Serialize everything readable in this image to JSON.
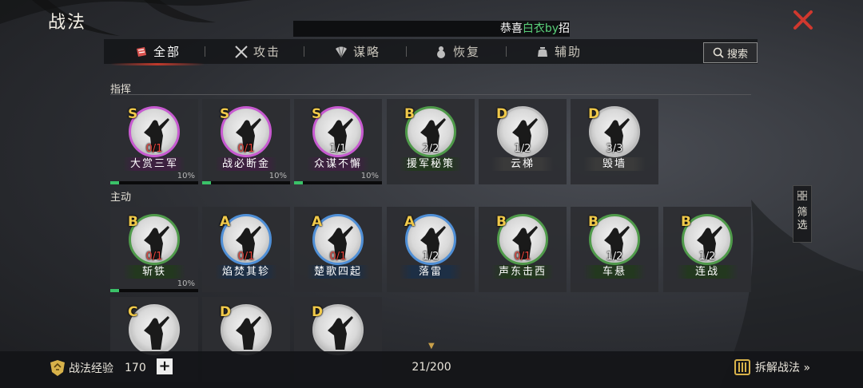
{
  "header": {
    "title": "战法",
    "marquee": {
      "prefix": "恭喜",
      "highlight": "白衣by",
      "suffix": "招"
    },
    "close_icon": "close-icon",
    "accent_color": "#c0392b"
  },
  "tabs": [
    {
      "label": "全部",
      "icon": "scroll-icon",
      "active": true
    },
    {
      "label": "攻击",
      "icon": "crossed-swords-icon",
      "active": false
    },
    {
      "label": "谋略",
      "icon": "fan-icon",
      "active": false
    },
    {
      "label": "恢复",
      "icon": "gourd-icon",
      "active": false
    },
    {
      "label": "辅助",
      "icon": "pouch-icon",
      "active": false
    }
  ],
  "search": {
    "label": "搜索",
    "icon": "search-icon"
  },
  "sections": [
    {
      "title": "指挥",
      "cards": [
        {
          "grade": "S",
          "count": "0/1",
          "count_red": true,
          "name": "大赏三军",
          "percent": "10%",
          "progress": 0.1
        },
        {
          "grade": "S",
          "count": "0/1",
          "count_red": true,
          "name": "战必断金",
          "percent": "10%",
          "progress": 0.1
        },
        {
          "grade": "S",
          "count": "1/1",
          "count_red": false,
          "name": "众谋不懈",
          "percent": "10%",
          "progress": 0.1
        },
        {
          "grade": "B",
          "count": "2/2",
          "count_red": false,
          "name": "援军秘策",
          "percent": "",
          "progress": 0
        },
        {
          "grade": "D",
          "count": "1/2",
          "count_red": false,
          "name": "云梯",
          "percent": "",
          "progress": 0
        },
        {
          "grade": "D",
          "count": "3/3",
          "count_red": false,
          "name": "毁墙",
          "percent": "",
          "progress": 0
        }
      ]
    },
    {
      "title": "主动",
      "cards": [
        {
          "grade": "B",
          "count": "0/1",
          "count_red": true,
          "name": "斩铁",
          "percent": "10%",
          "progress": 0.1
        },
        {
          "grade": "A",
          "count": "0/1",
          "count_red": true,
          "name": "焰焚其轸",
          "percent": "",
          "progress": 0
        },
        {
          "grade": "A",
          "count": "0/1",
          "count_red": true,
          "name": "楚歌四起",
          "percent": "",
          "progress": 0
        },
        {
          "grade": "A",
          "count": "1/2",
          "count_red": false,
          "name": "落雷",
          "percent": "",
          "progress": 0
        },
        {
          "grade": "B",
          "count": "0/1",
          "count_red": true,
          "name": "声东击西",
          "percent": "",
          "progress": 0
        },
        {
          "grade": "B",
          "count": "1/2",
          "count_red": false,
          "name": "车悬",
          "percent": "",
          "progress": 0
        },
        {
          "grade": "B",
          "count": "1/2",
          "count_red": false,
          "name": "连战",
          "percent": "",
          "progress": 0
        },
        {
          "grade": "C",
          "count": "",
          "count_red": false,
          "name": "",
          "percent": "",
          "progress": 0
        },
        {
          "grade": "D",
          "count": "",
          "count_red": false,
          "name": "",
          "percent": "",
          "progress": 0
        },
        {
          "grade": "D",
          "count": "",
          "count_red": false,
          "name": "",
          "percent": "",
          "progress": 0
        }
      ]
    }
  ],
  "filter": {
    "label": "筛选",
    "icon": "grid-icon"
  },
  "footer": {
    "exp_label": "战法经验",
    "exp_value": "170",
    "plus": "+",
    "page_count": "21/200",
    "dismantle_label": "拆解战法 »"
  },
  "grade_colors": {
    "S": "#c75ad0",
    "A": "#4f8fd6",
    "B": "#4f9a4a",
    "C": "#c8c8c8",
    "D": "#bdbdbd"
  }
}
